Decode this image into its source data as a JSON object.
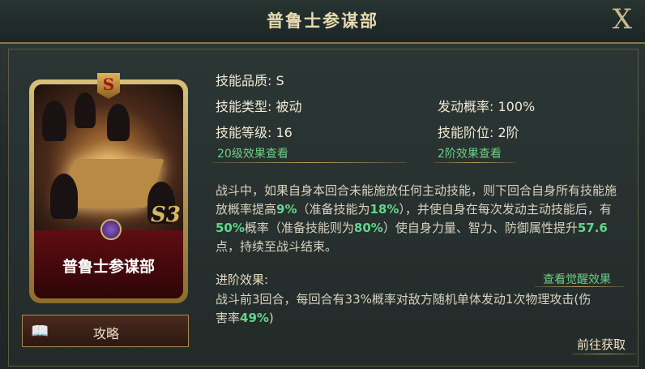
{
  "title": "普鲁士参谋部",
  "close_label": "X",
  "card": {
    "rank_letter": "S",
    "name": "普鲁士参谋部",
    "level_mark": "S3"
  },
  "guide_label": "攻略",
  "info": {
    "quality_label": "技能品质:",
    "quality_value": "S",
    "type_label": "技能类型:",
    "type_value": "被动",
    "chance_label": "发动概率:",
    "chance_value": "100%",
    "level_label": "技能等级:",
    "level_value": "16",
    "stage_label": "技能阶位:",
    "stage_value": "2阶",
    "level20_link": "20级效果查看",
    "stage2_link": "2阶效果查看"
  },
  "description": {
    "t1": "战斗中，如果自身本回合未能施放任何主动技能，则下回合自身所有技能施放概率提高",
    "v1": "9%",
    "t2": "（准备技能为",
    "v2": "18%",
    "t3": "），并使自身在每次发动主动技能后，有",
    "v3": "50%",
    "t4": "概率（准备技能则为",
    "v4": "80%",
    "t5": "）使自身力量、智力、防御属性提升",
    "v5": "57.6",
    "t6": "点，持续至战斗结束。"
  },
  "advance": {
    "header": "进阶效果:",
    "awaken_link": "查看觉醒效果",
    "t1": "战斗前3回合，每回合有33%概率对敌方随机单体发动1次物理攻击(伤害率",
    "v1": "49%",
    "t2": ")"
  },
  "goto_label": "前往获取"
}
